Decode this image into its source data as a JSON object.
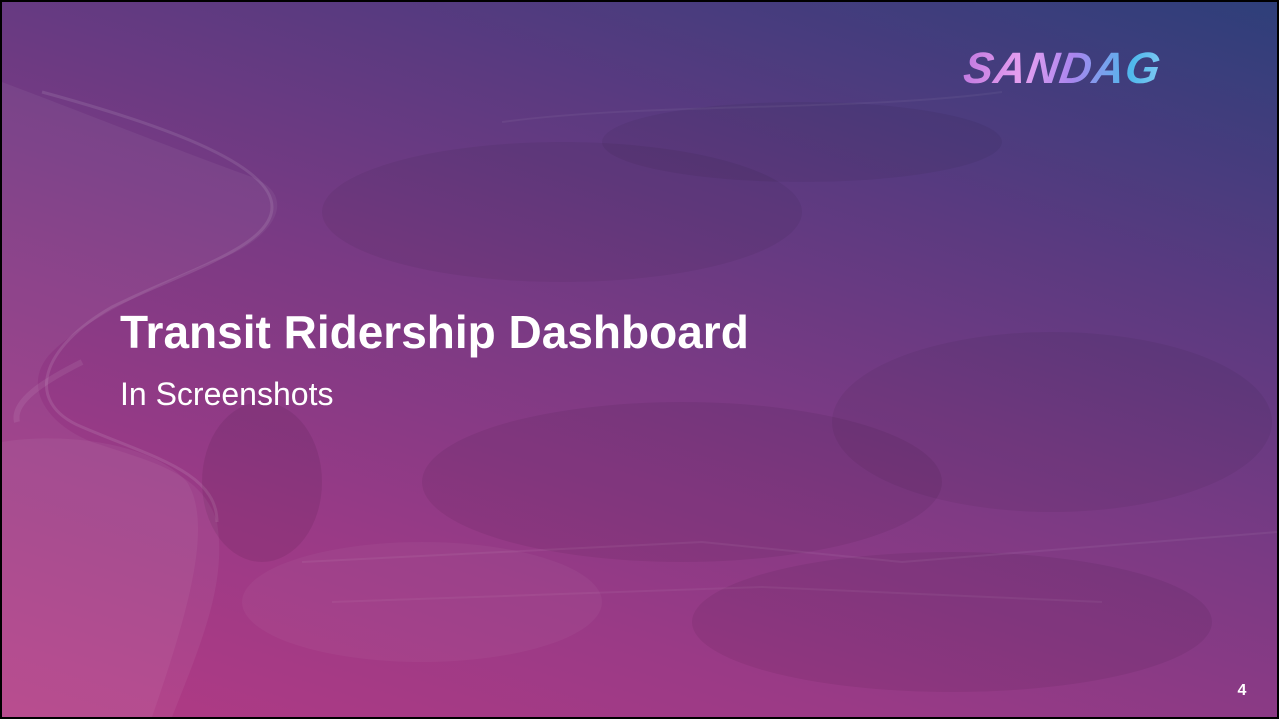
{
  "slide": {
    "logo_text": "SANDAG",
    "title": "Transit Ridership Dashboard",
    "subtitle": "In Screenshots",
    "page_number": "4"
  },
  "colors": {
    "gradient_pink": "#b23a84",
    "gradient_purple": "#7a3a84",
    "gradient_blue": "#2e3f7a",
    "text": "#ffffff"
  }
}
